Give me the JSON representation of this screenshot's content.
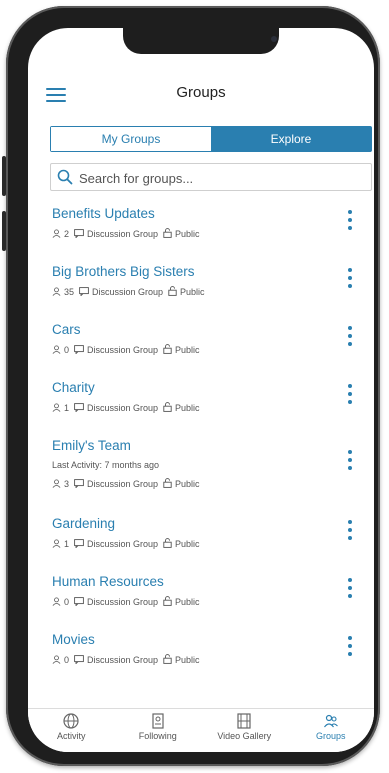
{
  "header": {
    "title": "Groups"
  },
  "segmented": {
    "tabs": [
      "My Groups",
      "Explore"
    ],
    "active": "My Groups"
  },
  "search": {
    "placeholder": "Search for groups..."
  },
  "groups": [
    {
      "name": "Benefits Updates",
      "members": "2",
      "type": "Discussion Group",
      "privacy": "Public"
    },
    {
      "name": "Big Brothers Big Sisters",
      "members": "35",
      "type": "Discussion Group",
      "privacy": "Public"
    },
    {
      "name": "Cars",
      "members": "0",
      "type": "Discussion Group",
      "privacy": "Public"
    },
    {
      "name": "Charity",
      "members": "1",
      "type": "Discussion Group",
      "privacy": "Public"
    },
    {
      "name": "Emily's Team",
      "activity": "Last Activity: 7 months ago",
      "members": "3",
      "type": "Discussion Group",
      "privacy": "Public"
    },
    {
      "name": "Gardening",
      "members": "1",
      "type": "Discussion Group",
      "privacy": "Public"
    },
    {
      "name": "Human Resources",
      "members": "0",
      "type": "Discussion Group",
      "privacy": "Public"
    },
    {
      "name": "Movies",
      "members": "0",
      "type": "Discussion Group",
      "privacy": "Public"
    }
  ],
  "tabbar": {
    "items": [
      {
        "label": "Activity",
        "icon": "globe-icon"
      },
      {
        "label": "Following",
        "icon": "following-icon"
      },
      {
        "label": "Video Gallery",
        "icon": "film-icon"
      },
      {
        "label": "Groups",
        "icon": "groups-icon"
      }
    ],
    "active": "Groups"
  },
  "colors": {
    "accent": "#2a7fb0",
    "text": "#222222",
    "muted": "#555555"
  }
}
